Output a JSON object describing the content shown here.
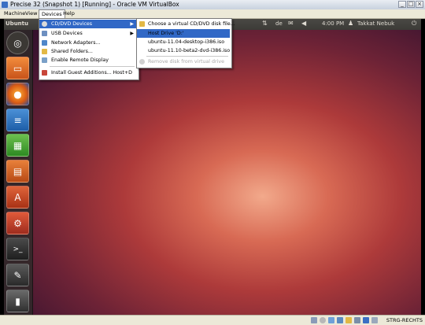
{
  "window": {
    "title": "Precise 32 (Snapshot 1) [Running] - Oracle VM VirtualBox"
  },
  "menubar": {
    "items": [
      "Machine",
      "View",
      "Devices",
      "Help"
    ]
  },
  "guest_panel": {
    "title": "Ubuntu",
    "keyboard": "de",
    "clock": "4:00 PM",
    "user": "Takkat Nebuk"
  },
  "devices_menu": {
    "items": [
      {
        "label": "CD/DVD Devices",
        "icon": "cd-dvd-icon",
        "submenu": true,
        "highlighted": true
      },
      {
        "label": "USB Devices",
        "icon": "usb-icon",
        "submenu": true
      },
      {
        "label": "Network Adapters...",
        "icon": "network-icon"
      },
      {
        "label": "Shared Folders...",
        "icon": "shared-folder-icon"
      },
      {
        "label": "Enable Remote Display",
        "icon": "remote-display-icon"
      },
      {
        "label": "Install Guest Additions...",
        "icon": "guest-additions-icon",
        "shortcut": "Host+D"
      }
    ]
  },
  "cd_submenu": {
    "items": [
      {
        "label": "Choose a virtual CD/DVD disk file...",
        "enabled": true
      },
      {
        "label": "Host Drive 'D:'",
        "enabled": true,
        "highlighted": true
      },
      {
        "label": "ubuntu-11.04-desktop-i386.iso",
        "enabled": true
      },
      {
        "label": "ubuntu-11.10-beta2-dvd-i386.iso",
        "enabled": true
      },
      {
        "label": "Remove disk from virtual drive",
        "enabled": false
      }
    ]
  },
  "launcher": {
    "items": [
      "dash-home-icon",
      "files-icon",
      "firefox-icon",
      "writer-icon",
      "calc-icon",
      "impress-icon",
      "software-center-icon",
      "settings-icon",
      "terminal-icon",
      "editor-icon",
      "trash-icon"
    ]
  },
  "statusbar": {
    "host_key": "STRG-RECHTS"
  },
  "colors": {
    "highlight": "#3168c6",
    "menubar": "#ece9d8",
    "panel": "#3c3b37"
  }
}
